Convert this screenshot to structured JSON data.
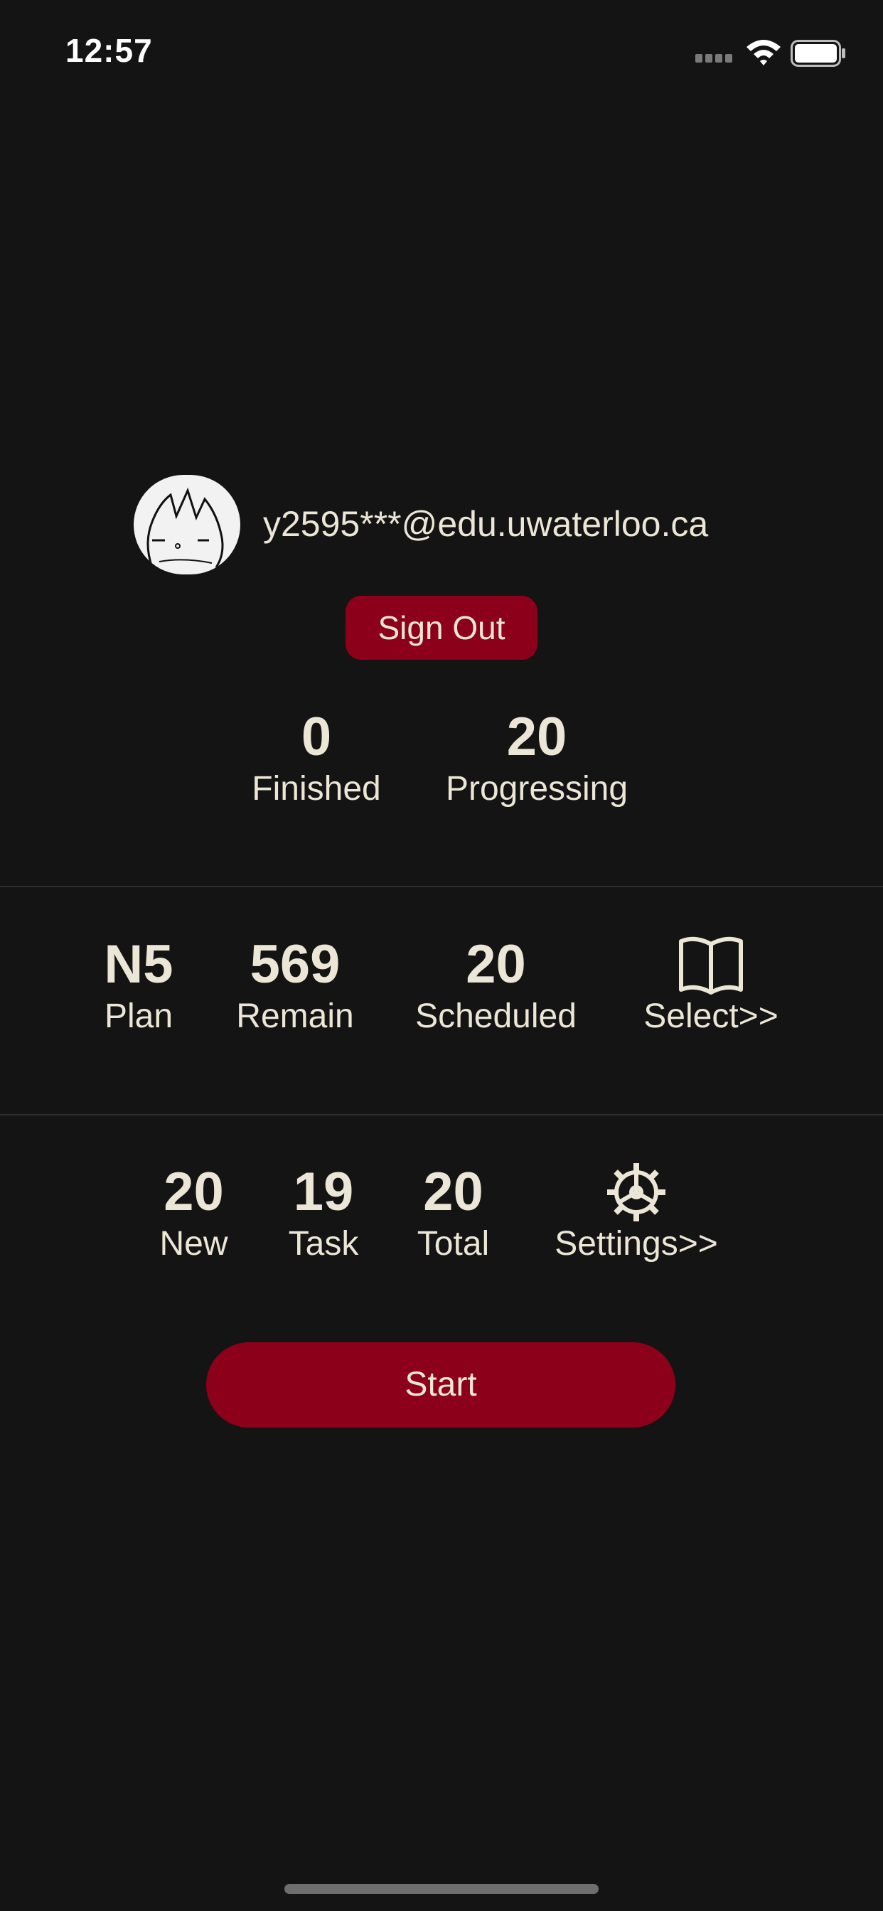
{
  "status_bar": {
    "time": "12:57"
  },
  "profile": {
    "email": "y2595***@edu.uwaterloo.ca",
    "avatar_icon": "cat-avatar-icon"
  },
  "sign_out_label": "Sign Out",
  "progress": {
    "finished": {
      "value": "0",
      "label": "Finished"
    },
    "progressing": {
      "value": "20",
      "label": "Progressing"
    }
  },
  "plan_section": {
    "plan": {
      "value": "N5",
      "label": "Plan"
    },
    "remain": {
      "value": "569",
      "label": "Remain"
    },
    "scheduled": {
      "value": "20",
      "label": "Scheduled"
    },
    "select": {
      "icon": "open-book-icon",
      "label": "Select>>"
    }
  },
  "task_section": {
    "new": {
      "value": "20",
      "label": "New"
    },
    "task": {
      "value": "19",
      "label": "Task"
    },
    "total": {
      "value": "20",
      "label": "Total"
    },
    "settings": {
      "icon": "gear-icon",
      "label": "Settings>>"
    }
  },
  "start_label": "Start",
  "colors": {
    "background": "#141414",
    "accent": "#8d0019",
    "text": "#ebe6d6"
  }
}
